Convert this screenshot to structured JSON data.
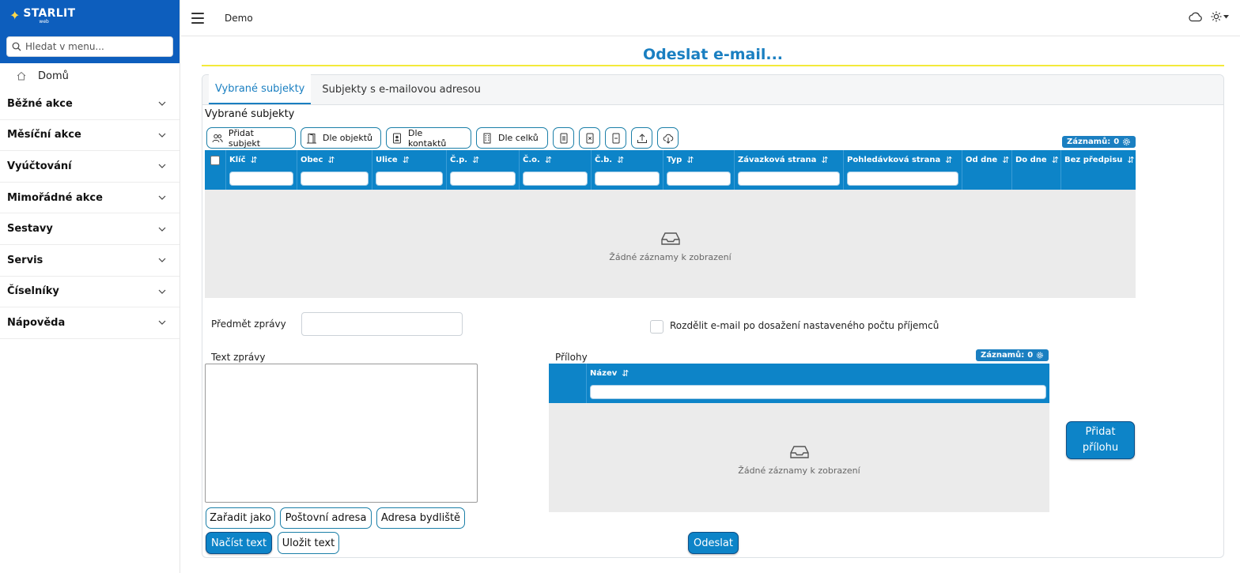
{
  "brand": {
    "name": "STARLIT",
    "sub": "web"
  },
  "search": {
    "placeholder": "Hledat v menu..."
  },
  "nav": {
    "home_label": "Domů",
    "items": [
      {
        "label": "Běžné akce"
      },
      {
        "label": "Měsíční akce"
      },
      {
        "label": "Vyúčtování"
      },
      {
        "label": "Mimořádné akce"
      },
      {
        "label": "Sestavy"
      },
      {
        "label": "Servis"
      },
      {
        "label": "Číselníky"
      },
      {
        "label": "Nápověda"
      }
    ]
  },
  "topbar": {
    "context": "Demo"
  },
  "page": {
    "title": "Odeslat e-mail..."
  },
  "tabs": [
    {
      "label": "Vybrané subjekty",
      "active": true
    },
    {
      "label": "Subjekty s e-mailovou adresou",
      "active": false
    }
  ],
  "subjects": {
    "section_label": "Vybrané subjekty",
    "toolbar": {
      "add_subject": "Přidat subjekt",
      "by_objects": "Dle objektů",
      "by_contacts": "Dle kontaktů",
      "by_units": "Dle celků"
    },
    "records_label": "Záznamů:",
    "records_count": "0",
    "columns": [
      "Klíč",
      "Obec",
      "Ulice",
      "Č.p.",
      "Č.o.",
      "Č.b.",
      "Typ",
      "Závazková strana",
      "Pohledávková strana",
      "Od dne",
      "Do dne",
      "Bez předpisu"
    ],
    "empty_text": "Žádné záznamy k zobrazení"
  },
  "form": {
    "subject_label": "Předmět zprávy",
    "subject_value": "",
    "split_label": "Rozdělit e-mail po dosažení nastaveného počtu příjemců",
    "split_checked": false,
    "text_label": "Text zprávy",
    "text_value": "",
    "insert_as": "Zařadit jako",
    "postal_address": "Poštovní adresa",
    "residence_address": "Adresa bydliště",
    "load_text": "Načíst text",
    "save_text": "Uložit text",
    "send": "Odeslat"
  },
  "attachments": {
    "label": "Přílohy",
    "records_label": "Záznamů:",
    "records_count": "0",
    "columns": [
      "Název"
    ],
    "empty_text": "Žádné záznamy k zobrazení",
    "add_button": "Přidat přílohu"
  },
  "colors": {
    "brand_blue": "#0d5ebd",
    "accent": "#0d84c8",
    "title": "#1a7fc1",
    "title_underline": "#f3ea3a"
  }
}
